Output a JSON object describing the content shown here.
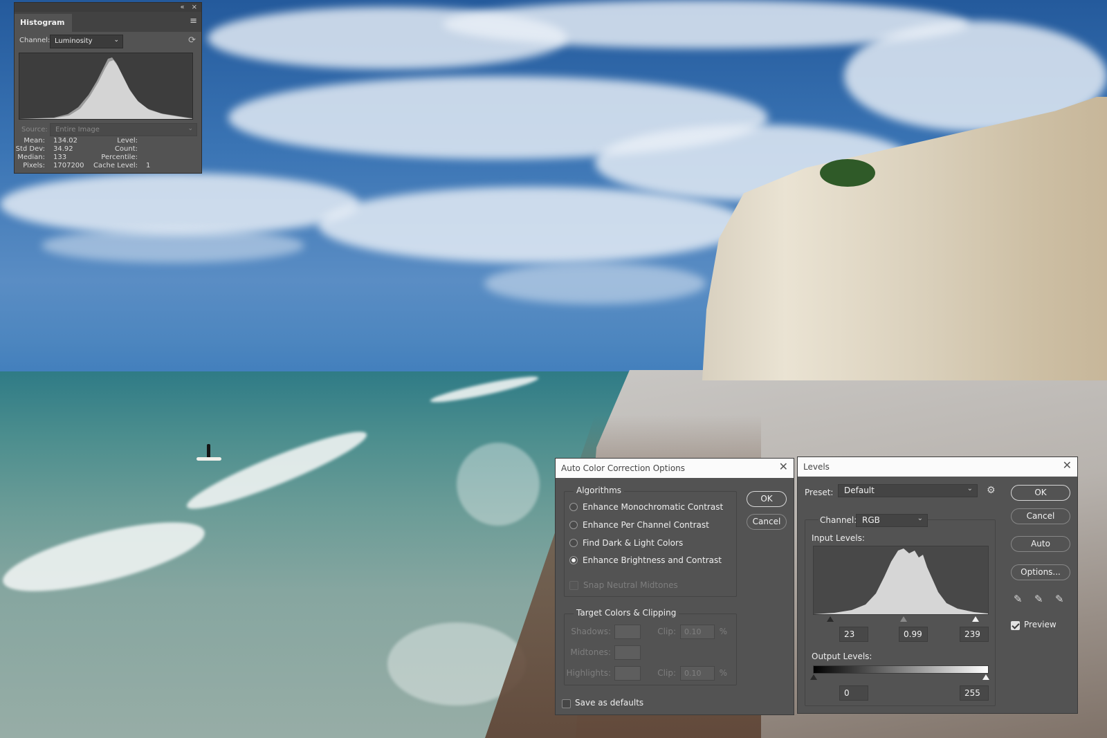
{
  "histogram_panel": {
    "tab_label": "Histogram",
    "collapse_icon": "«",
    "close_icon": "×",
    "menu_icon": "≡",
    "channel_label": "Channel:",
    "channel_value": "Luminosity",
    "source_label": "Source:",
    "source_value": "Entire Image",
    "stats": [
      {
        "label": "Mean:",
        "value": "134.02"
      },
      {
        "label": "Std Dev:",
        "value": "34.92"
      },
      {
        "label": "Median:",
        "value": "133"
      },
      {
        "label": "Pixels:",
        "value": "1707200"
      }
    ],
    "stats_right": [
      {
        "label": "Level:",
        "value": ""
      },
      {
        "label": "Count:",
        "value": ""
      },
      {
        "label": "Percentile:",
        "value": ""
      },
      {
        "label": "Cache Level:",
        "value": "1"
      }
    ]
  },
  "auto_color_dialog": {
    "title": "Auto Color Correction Options",
    "algorithms_title": "Algorithms",
    "options": [
      {
        "label": "Enhance Monochromatic Contrast",
        "selected": false
      },
      {
        "label": "Enhance Per Channel Contrast",
        "selected": false
      },
      {
        "label": "Find Dark & Light Colors",
        "selected": false
      },
      {
        "label": "Enhance Brightness and Contrast",
        "selected": true
      }
    ],
    "snap_label": "Snap Neutral Midtones",
    "target_title": "Target Colors & Clipping",
    "shadows_label": "Shadows:",
    "midtones_label": "Midtones:",
    "highlights_label": "Highlights:",
    "clip_label": "Clip:",
    "shadows_clip": "0.10",
    "highlights_clip": "0.10",
    "percent": "%",
    "save_defaults_label": "Save as defaults",
    "ok_label": "OK",
    "cancel_label": "Cancel"
  },
  "levels_dialog": {
    "title": "Levels",
    "preset_label": "Preset:",
    "preset_value": "Default",
    "channel_label": "Channel:",
    "channel_value": "RGB",
    "input_levels_label": "Input Levels:",
    "input_black": "23",
    "input_gamma": "0.99",
    "input_white": "239",
    "output_levels_label": "Output Levels:",
    "output_black": "0",
    "output_white": "255",
    "ok_label": "OK",
    "cancel_label": "Cancel",
    "auto_label": "Auto",
    "options_label": "Options...",
    "preview_label": "Preview",
    "preview_checked": true
  }
}
